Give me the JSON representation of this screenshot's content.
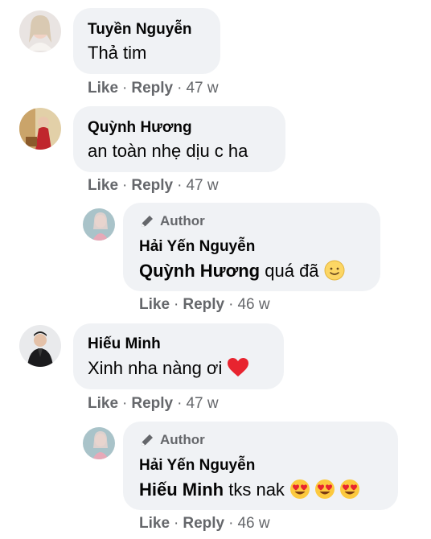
{
  "comments": [
    {
      "author": "Tuyền Nguyễn",
      "text": "Thả tim",
      "like": "Like",
      "reply": "Reply",
      "time": "47 w"
    },
    {
      "author": "Quỳnh Hương",
      "text": "an toàn nhẹ dịu c ha",
      "like": "Like",
      "reply": "Reply",
      "time": "47 w"
    },
    {
      "badge": "Author",
      "author": "Hải Yến Nguyễn",
      "mention": "Quỳnh Hương",
      "text": "quá đã",
      "emoji": "slightly-smiling-face",
      "like": "Like",
      "reply": "Reply",
      "time": "46 w"
    },
    {
      "author": "Hiếu Minh",
      "text": "Xinh nha nàng ơi",
      "emoji": "red-heart",
      "like": "Like",
      "reply": "Reply",
      "time": "47 w"
    },
    {
      "badge": "Author",
      "author": "Hải Yến Nguyễn",
      "mention": "Hiếu Minh",
      "text": "tks nak",
      "emoji": "heart-eyes x3",
      "like": "Like",
      "reply": "Reply",
      "time": "46 w"
    }
  ],
  "colors": {
    "bubble": "#f0f2f5",
    "secondary_text": "#65676b",
    "primary_text": "#050505"
  }
}
